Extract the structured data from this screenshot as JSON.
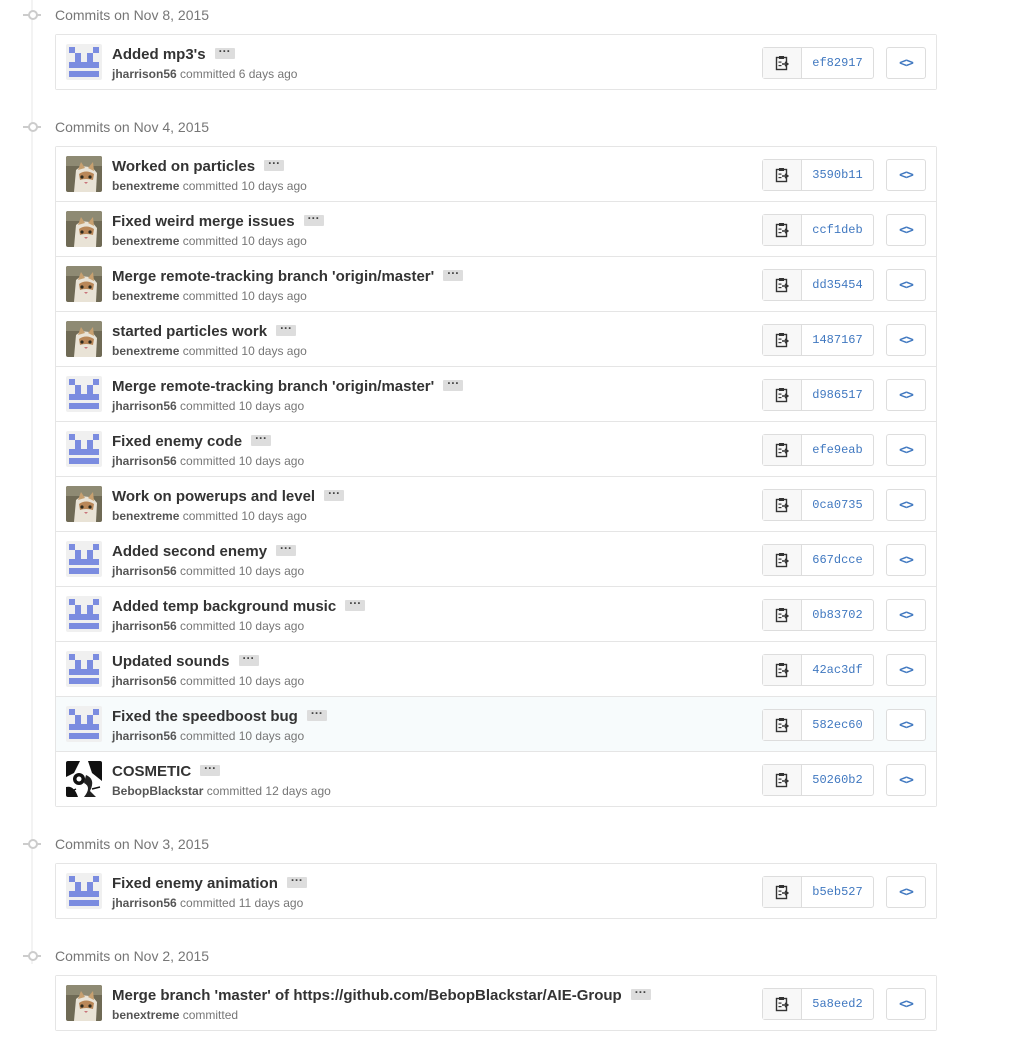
{
  "groups": [
    {
      "date_label": "Commits on Nov 8, 2015",
      "commits": [
        {
          "message": "Added mp3's",
          "author": "jharrison56",
          "avatar": "identicon",
          "verb": "committed",
          "time": "6 days ago",
          "sha": "ef82917"
        }
      ]
    },
    {
      "date_label": "Commits on Nov 4, 2015",
      "commits": [
        {
          "message": "Worked on particles",
          "author": "benextreme",
          "avatar": "cat",
          "verb": "committed",
          "time": "10 days ago",
          "sha": "3590b11"
        },
        {
          "message": "Fixed weird merge issues",
          "author": "benextreme",
          "avatar": "cat",
          "verb": "committed",
          "time": "10 days ago",
          "sha": "ccf1deb"
        },
        {
          "message": "Merge remote-tracking branch 'origin/master'",
          "author": "benextreme",
          "avatar": "cat",
          "verb": "committed",
          "time": "10 days ago",
          "sha": "dd35454"
        },
        {
          "message": "started particles work",
          "author": "benextreme",
          "avatar": "cat",
          "verb": "committed",
          "time": "10 days ago",
          "sha": "1487167"
        },
        {
          "message": "Merge remote-tracking branch 'origin/master'",
          "author": "jharrison56",
          "avatar": "identicon",
          "verb": "committed",
          "time": "10 days ago",
          "sha": "d986517"
        },
        {
          "message": "Fixed enemy code",
          "author": "jharrison56",
          "avatar": "identicon",
          "verb": "committed",
          "time": "10 days ago",
          "sha": "efe9eab"
        },
        {
          "message": "Work on powerups and level",
          "author": "benextreme",
          "avatar": "cat",
          "verb": "committed",
          "time": "10 days ago",
          "sha": "0ca0735"
        },
        {
          "message": "Added second enemy",
          "author": "jharrison56",
          "avatar": "identicon",
          "verb": "committed",
          "time": "10 days ago",
          "sha": "667dcce"
        },
        {
          "message": "Added temp background music",
          "author": "jharrison56",
          "avatar": "identicon",
          "verb": "committed",
          "time": "10 days ago",
          "sha": "0b83702"
        },
        {
          "message": "Updated sounds",
          "author": "jharrison56",
          "avatar": "identicon",
          "verb": "committed",
          "time": "10 days ago",
          "sha": "42ac3df"
        },
        {
          "message": "Fixed the speedboost bug",
          "author": "jharrison56",
          "avatar": "identicon",
          "verb": "committed",
          "time": "10 days ago",
          "sha": "582ec60",
          "hover": true
        },
        {
          "message": "COSMETIC",
          "author": "BebopBlackstar",
          "avatar": "bw",
          "verb": "committed",
          "time": "12 days ago",
          "sha": "50260b2"
        }
      ]
    },
    {
      "date_label": "Commits on Nov 3, 2015",
      "commits": [
        {
          "message": "Fixed enemy animation",
          "author": "jharrison56",
          "avatar": "identicon",
          "verb": "committed",
          "time": "11 days ago",
          "sha": "b5eb527"
        }
      ]
    },
    {
      "date_label": "Commits on Nov 2, 2015",
      "commits": [
        {
          "message": "Merge branch 'master' of https://github.com/BebopBlackstar/AIE-Group",
          "author": "benextreme",
          "avatar": "cat",
          "verb": "committed",
          "time": "",
          "sha": "5a8eed2"
        }
      ]
    }
  ],
  "ui": {
    "ellipsis": "···",
    "browse_glyph": "<>",
    "accent_color": "#4078c0",
    "icons": {
      "timeline": "git-commit-icon",
      "copy": "clipboard-icon",
      "browse": "code-icon",
      "expand": "ellipsis-icon"
    }
  }
}
